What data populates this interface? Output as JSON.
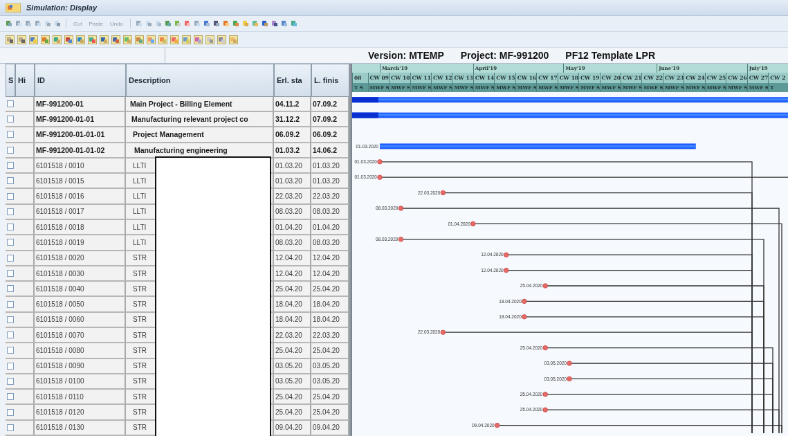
{
  "window": {
    "title": "Simulation: Display"
  },
  "standard_toolbar": {
    "buttons": [
      {
        "label": "Cut"
      },
      {
        "label": "Paste"
      },
      {
        "label": "Undo"
      }
    ]
  },
  "header": {
    "version": "Version: MTEMP",
    "project": "Project: MF-991200",
    "name": "PF12 Template LPR"
  },
  "table": {
    "columns": [
      "S",
      "Hi",
      "ID",
      "Description",
      "Erl. sta",
      "L. finis"
    ],
    "rows": [
      {
        "kind": "wbs",
        "checked": false,
        "id": "MF-991200-01",
        "description": "Main Project - Billing Element",
        "erl_sta": "04.11.2",
        "l_finis": "07.09.2",
        "gantt": {
          "kind": "summary"
        }
      },
      {
        "kind": "wbs",
        "checked": false,
        "id": "MF-991200-01-01",
        "description": "Manufacturing relevant project co",
        "erl_sta": "31.12.2",
        "l_finis": "07.09.2",
        "gantt": {
          "kind": "summary"
        }
      },
      {
        "kind": "wbs",
        "checked": false,
        "id": "MF-991200-01-01-01",
        "description": "Project Management",
        "erl_sta": "06.09.2",
        "l_finis": "06.09.2"
      },
      {
        "kind": "wbs",
        "checked": false,
        "id": "MF-991200-01-01-02",
        "description": "Manufacturing engineering",
        "erl_sta": "01.03.2",
        "l_finis": "14.06.2",
        "gantt": {
          "kind": "bar",
          "label": "01.03.2020"
        }
      },
      {
        "kind": "activity",
        "checked": false,
        "id": "6101518 / 0010",
        "description": "LLTI",
        "erl_sta": "01.03.20",
        "l_finis": "01.03.20",
        "gantt": {
          "kind": "milestone",
          "label": "01.03.2020",
          "link": {
            "kind": "a"
          }
        }
      },
      {
        "kind": "activity",
        "checked": false,
        "id": "6101518 / 0015",
        "description": "LLTI",
        "erl_sta": "01.03.20",
        "l_finis": "01.03.20",
        "gantt": {
          "kind": "milestone",
          "label": "01.03.2020",
          "link": {
            "kind": "edge"
          }
        }
      },
      {
        "kind": "activity",
        "checked": false,
        "id": "6101518 / 0016",
        "description": "LLTI",
        "erl_sta": "22.03.20",
        "l_finis": "22.03.20",
        "gantt": {
          "kind": "milestone",
          "label": "22.03.2020",
          "link": {
            "kind": "a"
          }
        }
      },
      {
        "kind": "activity",
        "checked": false,
        "id": "6101518 / 0017",
        "description": "LLTI",
        "erl_sta": "08.03.20",
        "l_finis": "08.03.20",
        "gantt": {
          "kind": "milestone",
          "label": "08.03.2020",
          "link": {
            "kind": "d"
          }
        }
      },
      {
        "kind": "activity",
        "checked": false,
        "id": "6101518 / 0018",
        "description": "LLTI",
        "erl_sta": "01.04.20",
        "l_finis": "01.04.20",
        "gantt": {
          "kind": "milestone",
          "label": "01.04.2020",
          "link": {
            "kind": "e"
          }
        }
      },
      {
        "kind": "activity",
        "checked": false,
        "id": "6101518 / 0019",
        "description": "LLTI",
        "erl_sta": "08.03.20",
        "l_finis": "08.03.20",
        "gantt": {
          "kind": "milestone",
          "label": "08.03.2020",
          "link": {
            "kind": "b"
          }
        }
      },
      {
        "kind": "activity",
        "checked": false,
        "id": "6101518 / 0020",
        "description": "STR",
        "erl_sta": "12.04.20",
        "l_finis": "12.04.20",
        "gantt": {
          "kind": "milestone",
          "label": "12.04.2020",
          "link": {
            "kind": "a"
          }
        }
      },
      {
        "kind": "activity",
        "checked": false,
        "id": "6101518 / 0030",
        "description": "STR",
        "erl_sta": "12.04.20",
        "l_finis": "12.04.20",
        "gantt": {
          "kind": "milestone",
          "label": "12.04.2020",
          "link": {
            "kind": "a"
          }
        }
      },
      {
        "kind": "activity",
        "checked": false,
        "id": "6101518 / 0040",
        "description": "STR",
        "erl_sta": "25.04.20",
        "l_finis": "25.04.20",
        "gantt": {
          "kind": "milestone",
          "label": "25.04.2020",
          "link": {
            "kind": "b"
          }
        }
      },
      {
        "kind": "activity",
        "checked": false,
        "id": "6101518 / 0050",
        "description": "STR",
        "erl_sta": "18.04.20",
        "l_finis": "18.04.20",
        "gantt": {
          "kind": "milestone",
          "label": "18.04.2020",
          "link": {
            "kind": "b"
          }
        }
      },
      {
        "kind": "activity",
        "checked": false,
        "id": "6101518 / 0060",
        "description": "STR",
        "erl_sta": "18.04.20",
        "l_finis": "18.04.20",
        "gantt": {
          "kind": "milestone",
          "label": "18.04.2020",
          "link": {
            "kind": "b"
          }
        }
      },
      {
        "kind": "activity",
        "checked": false,
        "id": "6101518 / 0070",
        "description": "STR",
        "erl_sta": "22.03.20",
        "l_finis": "22.03.20",
        "gantt": {
          "kind": "milestone",
          "label": "22.03.2020",
          "link": {
            "kind": "a"
          }
        }
      },
      {
        "kind": "activity",
        "checked": false,
        "id": "6101518 / 0080",
        "description": "STR",
        "erl_sta": "25.04.20",
        "l_finis": "25.04.20",
        "gantt": {
          "kind": "milestone",
          "label": "25.04.2020",
          "link": {
            "kind": "c"
          }
        }
      },
      {
        "kind": "activity",
        "checked": false,
        "id": "6101518 / 0090",
        "description": "STR",
        "erl_sta": "03.05.20",
        "l_finis": "03.05.20",
        "gantt": {
          "kind": "milestone",
          "label": "03.05.2020",
          "link": {
            "kind": "c"
          }
        }
      },
      {
        "kind": "activity",
        "checked": false,
        "id": "6101518 / 0100",
        "description": "STR",
        "erl_sta": "03.05.20",
        "l_finis": "03.05.20",
        "gantt": {
          "kind": "milestone",
          "label": "03.05.2020",
          "link": {
            "kind": "c"
          }
        }
      },
      {
        "kind": "activity",
        "checked": false,
        "id": "6101518 / 0110",
        "description": "STR",
        "erl_sta": "25.04.20",
        "l_finis": "25.04.20",
        "gantt": {
          "kind": "milestone",
          "label": "25.04.2020",
          "link": {
            "kind": "c"
          }
        }
      },
      {
        "kind": "activity",
        "checked": false,
        "id": "6101518 / 0120",
        "description": "STR",
        "erl_sta": "25.04.20",
        "l_finis": "25.04.20",
        "gantt": {
          "kind": "milestone",
          "label": "25.04.2020",
          "link": {
            "kind": "d"
          }
        }
      },
      {
        "kind": "activity",
        "checked": false,
        "id": "6101518 / 0130",
        "description": "STR",
        "erl_sta": "09.04.20",
        "l_finis": "09.04.20",
        "gantt": {
          "kind": "milestone",
          "label": "09.04.2020",
          "link": {
            "kind": "e"
          }
        }
      }
    ]
  },
  "timeline": {
    "months": [
      "March'19",
      "April'19",
      "May'19",
      "June'19",
      "July'19"
    ],
    "weeks": [
      {
        "label": "08",
        "days": "T S"
      },
      {
        "label": "CW 09",
        "days": "MWF S"
      },
      {
        "label": "CW 10",
        "days": "MWF S"
      },
      {
        "label": "CW 11",
        "days": "MWF S"
      },
      {
        "label": "CW 12",
        "days": "MWF S"
      },
      {
        "label": "CW 13",
        "days": "MWF S"
      },
      {
        "label": "CW 14",
        "days": "MWF S"
      },
      {
        "label": "CW 15",
        "days": "MWF S"
      },
      {
        "label": "CW 16",
        "days": "MWF S"
      },
      {
        "label": "CW 17",
        "days": "MWF S"
      },
      {
        "label": "CW 18",
        "days": "MWF S"
      },
      {
        "label": "CW 19",
        "days": "MWF S"
      },
      {
        "label": "CW 20",
        "days": "MWF S"
      },
      {
        "label": "CW 21",
        "days": "MWF S"
      },
      {
        "label": "CW 22",
        "days": "MWF S"
      },
      {
        "label": "CW 23",
        "days": "MWF S"
      },
      {
        "label": "CW 24",
        "days": "MWF S"
      },
      {
        "label": "CW 25",
        "days": "MWF S"
      },
      {
        "label": "CW 26",
        "days": "MWF S"
      },
      {
        "label": "CW 27",
        "days": "MWF S"
      },
      {
        "label": "CW 2",
        "days": "T"
      }
    ]
  }
}
